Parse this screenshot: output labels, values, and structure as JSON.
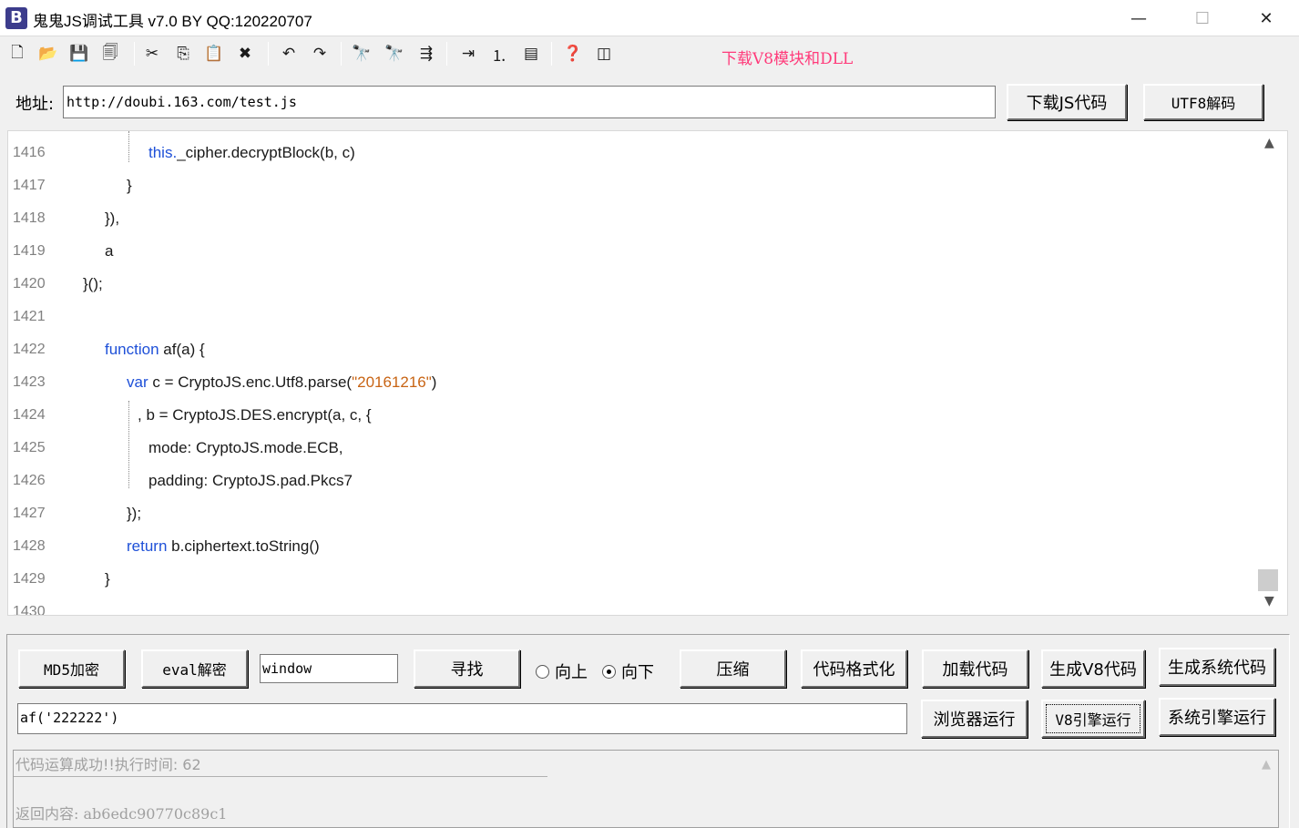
{
  "window": {
    "app_icon_letter": "B",
    "title": "鬼鬼JS调试工具 v7.0 BY QQ:120220707",
    "minimize": "—",
    "maximize": "☐",
    "close": "✕"
  },
  "toolbar": {
    "icons": [
      {
        "name": "new-file-icon",
        "glyph": "🗋"
      },
      {
        "name": "open-folder-icon",
        "glyph": "📂"
      },
      {
        "name": "save-icon",
        "glyph": "💾"
      },
      {
        "name": "save-all-icon",
        "glyph": "🗐"
      },
      {
        "name": "cut-icon",
        "glyph": "✂"
      },
      {
        "name": "copy-icon",
        "glyph": "⎘"
      },
      {
        "name": "paste-icon",
        "glyph": "📋"
      },
      {
        "name": "delete-icon",
        "glyph": "✖"
      },
      {
        "name": "undo-icon",
        "glyph": "↶"
      },
      {
        "name": "redo-icon",
        "glyph": "↷"
      },
      {
        "name": "find-icon",
        "glyph": "🔭"
      },
      {
        "name": "find-next-icon",
        "glyph": "🔭"
      },
      {
        "name": "goto-line-icon",
        "glyph": "⇶"
      },
      {
        "name": "indent-icon",
        "glyph": "⇥"
      },
      {
        "name": "numbered-list-icon",
        "glyph": "⒈"
      },
      {
        "name": "window-icon",
        "glyph": "▤"
      },
      {
        "name": "help-icon",
        "glyph": "❓"
      },
      {
        "name": "column-icon",
        "glyph": "◫"
      }
    ],
    "download_link": "下载V8模块和DLL"
  },
  "address": {
    "label": "地址:",
    "value": "http://doubi.163.com/test.js",
    "download_button": "下载JS代码",
    "utf8_button": "UTF8解码"
  },
  "editor": {
    "lines": [
      {
        "num": "1416",
        "parts": [
          {
            "t": "this.",
            "c": "kw"
          },
          {
            "t": "_cipher.decryptBlock(b, c)",
            "c": ""
          }
        ]
      },
      {
        "num": "1417",
        "parts": [
          {
            "t": "}",
            "c": ""
          }
        ]
      },
      {
        "num": "1418",
        "parts": [
          {
            "t": "}),",
            "c": ""
          }
        ]
      },
      {
        "num": "1419",
        "parts": [
          {
            "t": "a",
            "c": ""
          }
        ]
      },
      {
        "num": "1420",
        "parts": [
          {
            "t": "}();",
            "c": ""
          }
        ]
      },
      {
        "num": "1421",
        "parts": []
      },
      {
        "num": "1422",
        "parts": [
          {
            "t": "function",
            "c": "kw"
          },
          {
            "t": " af(a) {",
            "c": ""
          }
        ]
      },
      {
        "num": "1423",
        "parts": [
          {
            "t": "var",
            "c": "kw"
          },
          {
            "t": " c = CryptoJS.enc.Utf8.parse(",
            "c": ""
          },
          {
            "t": "\"20161216\"",
            "c": "str"
          },
          {
            "t": ")",
            "c": ""
          }
        ]
      },
      {
        "num": "1424",
        "parts": [
          {
            "t": ", b = CryptoJS.DES.encrypt(a, c, {",
            "c": ""
          }
        ]
      },
      {
        "num": "1425",
        "parts": [
          {
            "t": "mode: CryptoJS.mode.ECB,",
            "c": ""
          }
        ]
      },
      {
        "num": "1426",
        "parts": [
          {
            "t": "padding: CryptoJS.pad.Pkcs7",
            "c": ""
          }
        ]
      },
      {
        "num": "1427",
        "parts": [
          {
            "t": "});",
            "c": ""
          }
        ]
      },
      {
        "num": "1428",
        "parts": [
          {
            "t": "return",
            "c": "kw"
          },
          {
            "t": " b.ciphertext.toString()",
            "c": ""
          }
        ]
      },
      {
        "num": "1429",
        "parts": [
          {
            "t": "}",
            "c": ""
          }
        ]
      },
      {
        "num": "1430",
        "parts": []
      }
    ]
  },
  "controls": {
    "md5_button": "MD5加密",
    "eval_button": "eval解密",
    "search_value": "window",
    "find_button": "寻找",
    "radio_up": "向上",
    "radio_down": "向下",
    "compress_button": "压缩",
    "format_button": "代码格式化",
    "load_button": "加载代码",
    "gen_v8_button": "生成V8代码",
    "gen_sys_button": "生成系统代码",
    "eval_input": "af('222222')",
    "browser_run_button": "浏览器运行",
    "v8_run_button": "V8引擎运行",
    "sys_run_button": "系统引擎运行"
  },
  "output": {
    "status": "代码运算成功!!执行时间: 62",
    "result": "返回内容: ab6edc90770c89c1"
  }
}
